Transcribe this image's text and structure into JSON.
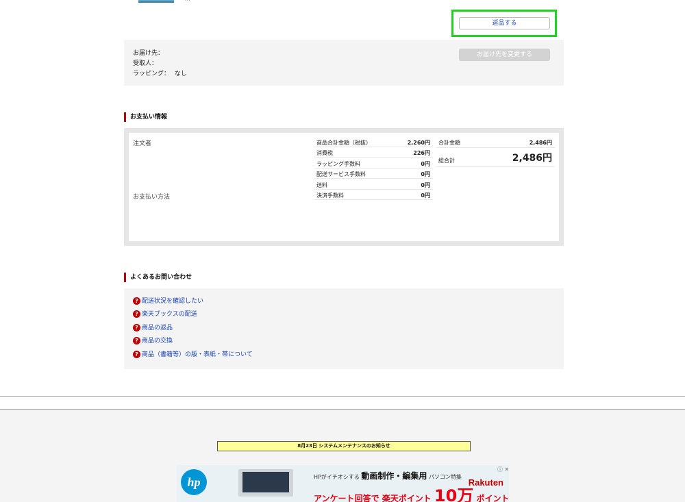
{
  "order": {
    "product_title_partial": "...",
    "return_button": "返品する"
  },
  "delivery": {
    "destination_label": "お届け先：",
    "recipient_label": "受取人：",
    "wrapping_label": "ラッピング：",
    "wrapping_value": "なし",
    "change_button": "お届け先を変更する"
  },
  "payment": {
    "section_title": "お支払い情報",
    "orderer_label": "注文者",
    "method_label": "お支払い方法",
    "fees": [
      {
        "label": "商品合計金額（税抜）",
        "value": "2,260円"
      },
      {
        "label": "消費税",
        "value": "226円"
      },
      {
        "label": "ラッピング手数料",
        "value": "0円"
      },
      {
        "label": "配送サービス手数料",
        "value": "0円"
      },
      {
        "label": "送料",
        "value": "0円"
      },
      {
        "label": "決済手数料",
        "value": "0円"
      }
    ],
    "total_amount_label": "合計金額",
    "total_amount_value": "2,486円",
    "grand_total_label": "総合計",
    "grand_total_value": "2,486円"
  },
  "faq": {
    "section_title": "よくあるお問い合わせ",
    "icon": "question-icon",
    "items": [
      "配送状況を確認したい",
      "楽天ブックスの配送",
      "商品の返品",
      "商品の交換",
      "商品（書籍等）の版・表紙・帯について"
    ]
  },
  "footer": {
    "maintenance_notice": "8月23日 システムメンテナンスのお知らせ"
  },
  "ad": {
    "logo": "hp",
    "line1_prefix": "HPがイチオシする",
    "line1_main": "動画制作・編集用",
    "line1_suffix": "パソコン特集",
    "line2_prefix": "アンケート回答で",
    "line2_sub": "楽天ポイント",
    "line2_big": "10万",
    "line2_suffix": "ポイント山分け!",
    "brand": "Rakuten",
    "close_glyph": "ⓘ ✕"
  },
  "colors": {
    "accent_red": "#bf0000",
    "link_blue": "#1a44b5",
    "highlight_green": "#21d321",
    "notice_yellow": "#ffff99"
  }
}
